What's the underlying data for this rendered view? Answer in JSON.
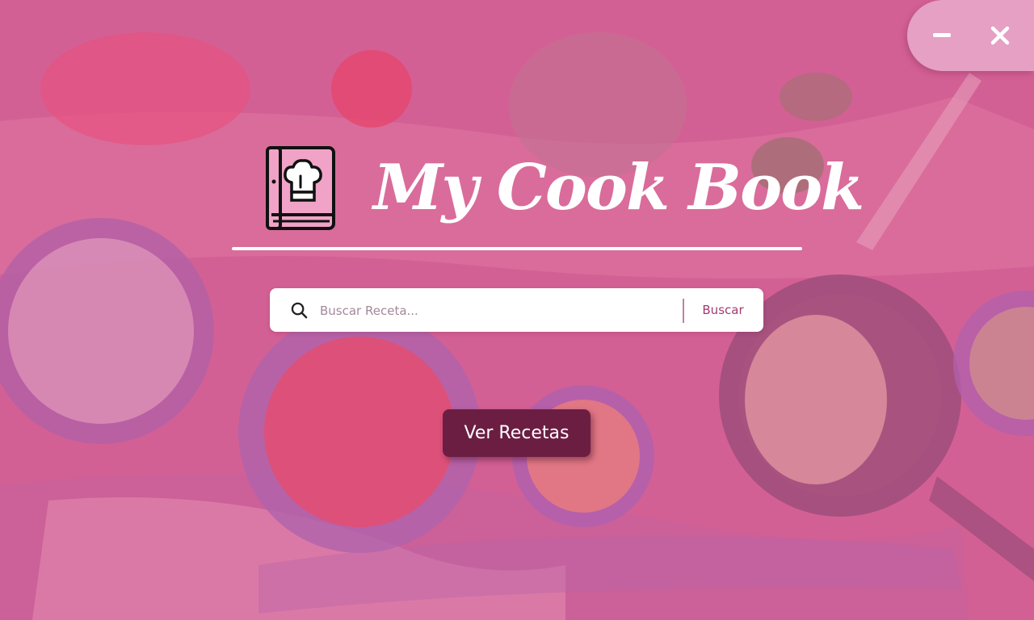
{
  "app": {
    "title": "My Cook Book"
  },
  "window_controls": {
    "minimize_icon": "minus-icon",
    "close_icon": "close-icon"
  },
  "search": {
    "placeholder": "Buscar Receta...",
    "value": "",
    "button_label": "Buscar",
    "icon": "search-icon"
  },
  "actions": {
    "primary_label": "Ver Recetas"
  },
  "colors": {
    "accent": "#6b1e42",
    "overlay": "#e27aad",
    "search_button_text": "#a23b70",
    "title_text": "#ffffff"
  }
}
